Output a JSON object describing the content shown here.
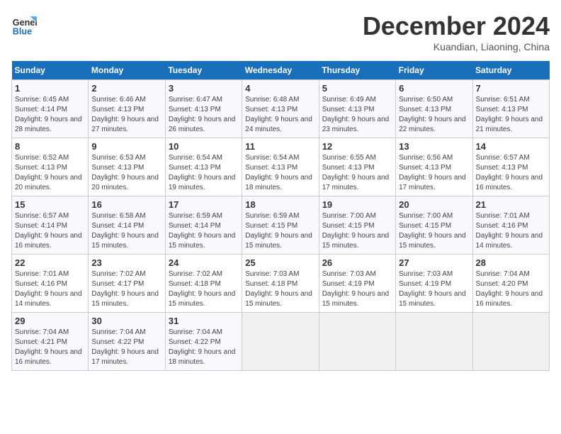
{
  "header": {
    "logo_line1": "General",
    "logo_line2": "Blue",
    "month": "December 2024",
    "location": "Kuandian, Liaoning, China"
  },
  "weekdays": [
    "Sunday",
    "Monday",
    "Tuesday",
    "Wednesday",
    "Thursday",
    "Friday",
    "Saturday"
  ],
  "weeks": [
    [
      {
        "day": 1,
        "sunrise": "6:45 AM",
        "sunset": "4:14 PM",
        "daylight": "9 hours and 28 minutes."
      },
      {
        "day": 2,
        "sunrise": "6:46 AM",
        "sunset": "4:13 PM",
        "daylight": "9 hours and 27 minutes."
      },
      {
        "day": 3,
        "sunrise": "6:47 AM",
        "sunset": "4:13 PM",
        "daylight": "9 hours and 26 minutes."
      },
      {
        "day": 4,
        "sunrise": "6:48 AM",
        "sunset": "4:13 PM",
        "daylight": "9 hours and 24 minutes."
      },
      {
        "day": 5,
        "sunrise": "6:49 AM",
        "sunset": "4:13 PM",
        "daylight": "9 hours and 23 minutes."
      },
      {
        "day": 6,
        "sunrise": "6:50 AM",
        "sunset": "4:13 PM",
        "daylight": "9 hours and 22 minutes."
      },
      {
        "day": 7,
        "sunrise": "6:51 AM",
        "sunset": "4:13 PM",
        "daylight": "9 hours and 21 minutes."
      }
    ],
    [
      {
        "day": 8,
        "sunrise": "6:52 AM",
        "sunset": "4:13 PM",
        "daylight": "9 hours and 20 minutes."
      },
      {
        "day": 9,
        "sunrise": "6:53 AM",
        "sunset": "4:13 PM",
        "daylight": "9 hours and 20 minutes."
      },
      {
        "day": 10,
        "sunrise": "6:54 AM",
        "sunset": "4:13 PM",
        "daylight": "9 hours and 19 minutes."
      },
      {
        "day": 11,
        "sunrise": "6:54 AM",
        "sunset": "4:13 PM",
        "daylight": "9 hours and 18 minutes."
      },
      {
        "day": 12,
        "sunrise": "6:55 AM",
        "sunset": "4:13 PM",
        "daylight": "9 hours and 17 minutes."
      },
      {
        "day": 13,
        "sunrise": "6:56 AM",
        "sunset": "4:13 PM",
        "daylight": "9 hours and 17 minutes."
      },
      {
        "day": 14,
        "sunrise": "6:57 AM",
        "sunset": "4:13 PM",
        "daylight": "9 hours and 16 minutes."
      }
    ],
    [
      {
        "day": 15,
        "sunrise": "6:57 AM",
        "sunset": "4:14 PM",
        "daylight": "9 hours and 16 minutes."
      },
      {
        "day": 16,
        "sunrise": "6:58 AM",
        "sunset": "4:14 PM",
        "daylight": "9 hours and 15 minutes."
      },
      {
        "day": 17,
        "sunrise": "6:59 AM",
        "sunset": "4:14 PM",
        "daylight": "9 hours and 15 minutes."
      },
      {
        "day": 18,
        "sunrise": "6:59 AM",
        "sunset": "4:15 PM",
        "daylight": "9 hours and 15 minutes."
      },
      {
        "day": 19,
        "sunrise": "7:00 AM",
        "sunset": "4:15 PM",
        "daylight": "9 hours and 15 minutes."
      },
      {
        "day": 20,
        "sunrise": "7:00 AM",
        "sunset": "4:15 PM",
        "daylight": "9 hours and 15 minutes."
      },
      {
        "day": 21,
        "sunrise": "7:01 AM",
        "sunset": "4:16 PM",
        "daylight": "9 hours and 14 minutes."
      }
    ],
    [
      {
        "day": 22,
        "sunrise": "7:01 AM",
        "sunset": "4:16 PM",
        "daylight": "9 hours and 14 minutes."
      },
      {
        "day": 23,
        "sunrise": "7:02 AM",
        "sunset": "4:17 PM",
        "daylight": "9 hours and 15 minutes."
      },
      {
        "day": 24,
        "sunrise": "7:02 AM",
        "sunset": "4:18 PM",
        "daylight": "9 hours and 15 minutes."
      },
      {
        "day": 25,
        "sunrise": "7:03 AM",
        "sunset": "4:18 PM",
        "daylight": "9 hours and 15 minutes."
      },
      {
        "day": 26,
        "sunrise": "7:03 AM",
        "sunset": "4:19 PM",
        "daylight": "9 hours and 15 minutes."
      },
      {
        "day": 27,
        "sunrise": "7:03 AM",
        "sunset": "4:19 PM",
        "daylight": "9 hours and 15 minutes."
      },
      {
        "day": 28,
        "sunrise": "7:04 AM",
        "sunset": "4:20 PM",
        "daylight": "9 hours and 16 minutes."
      }
    ],
    [
      {
        "day": 29,
        "sunrise": "7:04 AM",
        "sunset": "4:21 PM",
        "daylight": "9 hours and 16 minutes."
      },
      {
        "day": 30,
        "sunrise": "7:04 AM",
        "sunset": "4:22 PM",
        "daylight": "9 hours and 17 minutes."
      },
      {
        "day": 31,
        "sunrise": "7:04 AM",
        "sunset": "4:22 PM",
        "daylight": "9 hours and 18 minutes."
      },
      null,
      null,
      null,
      null
    ]
  ]
}
